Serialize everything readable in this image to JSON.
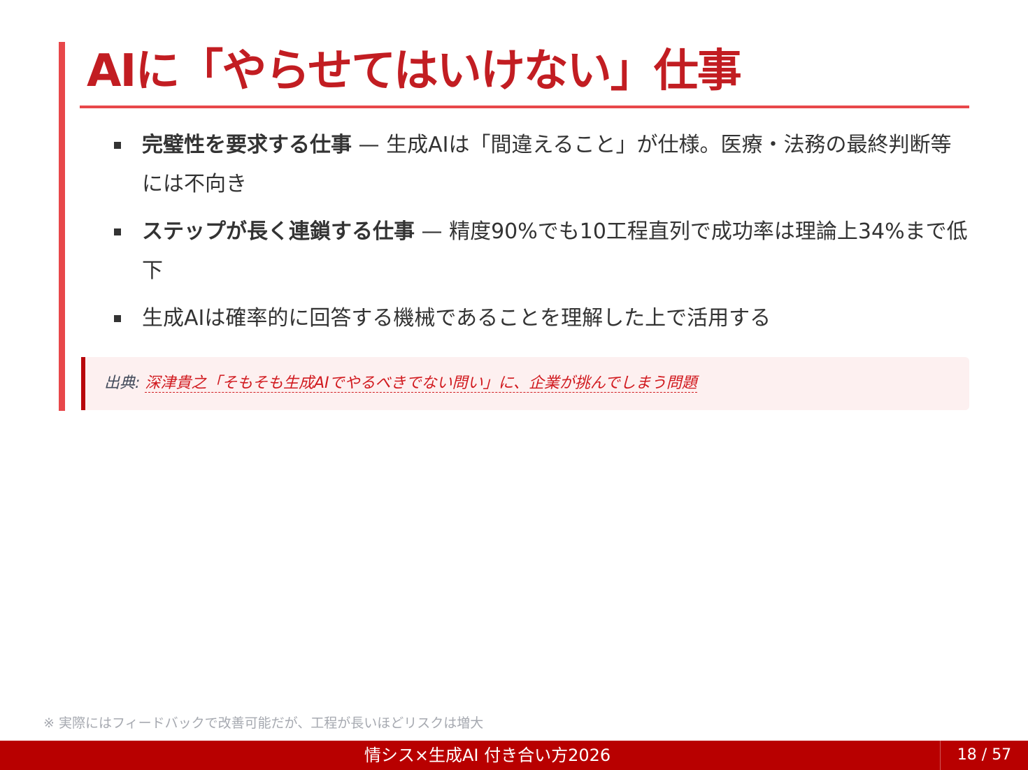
{
  "slide": {
    "title": "AIに「やらせてはいけない」仕事",
    "bullets": [
      {
        "strong": "完璧性を要求する仕事",
        "text": " — 生成AIは「間違えること」が仕様。医療・法務の最終判断等には不向き"
      },
      {
        "strong": "ステップが長く連鎖する仕事",
        "text": " — 精度90%でも10工程直列で成功率は理論上34%まで低下"
      },
      {
        "strong": "",
        "text": "生成AIは確率的に回答する機械であることを理解した上で活用する"
      }
    ],
    "source": {
      "label": "出典: ",
      "link_text": "深津貴之「そもそも生成AIでやるべきでない問い」に、企業が挑んでしまう問題"
    },
    "footnote": "※ 実際にはフィードバックで改善可能だが、工程が長いほどリスクは増大"
  },
  "footer": {
    "title": "情シス×生成AI 付き合い方2026",
    "page": "18 / 57"
  },
  "colors": {
    "title": "#c21d22",
    "accent": "#e8474a",
    "footer_bg": "#b80000",
    "source_bg": "#fdf0f0",
    "link": "#d11a1f"
  }
}
